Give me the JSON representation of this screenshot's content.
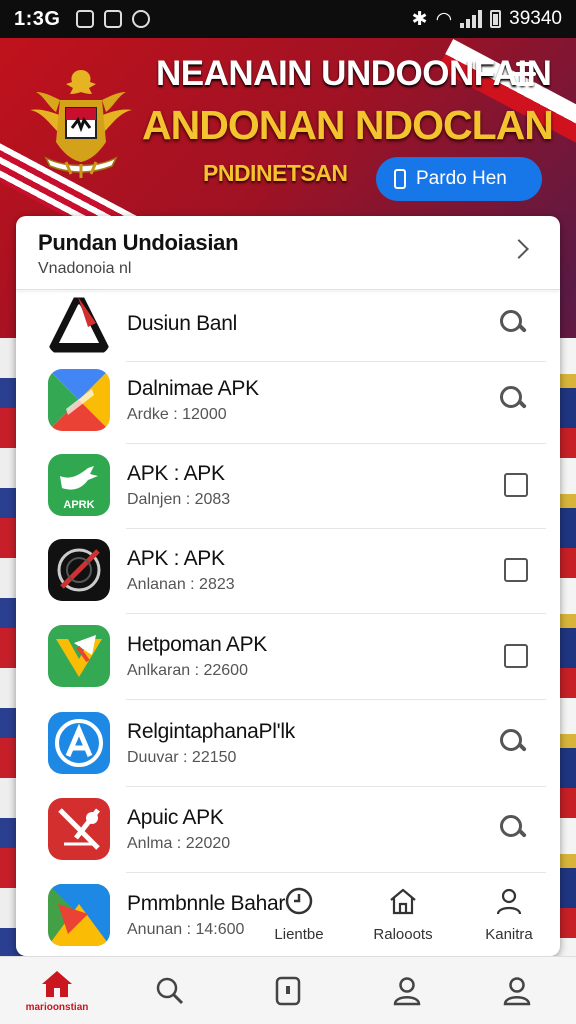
{
  "status_bar": {
    "time": "1:3G",
    "right_text": "39340"
  },
  "header": {
    "title_line1": "NEANAIN UNDOONFAIN",
    "title_line2": "ANDONAN NDOCLAN",
    "title_line3": "PNDINETSAN",
    "action_button_label": "Pardo Hen"
  },
  "panel": {
    "heading": "Pundan Undoiasian",
    "subheading": "Vnadonoia nl"
  },
  "apps": [
    {
      "name": "Dusiun Banl",
      "meta": "",
      "action_icon": "search-icon",
      "icon_color": "#ffffff"
    },
    {
      "name": "Dalnimae APK",
      "meta": "Ardke  : 12000",
      "action_icon": "search-icon",
      "icon_color": "#e94335"
    },
    {
      "name": "APK : APK",
      "meta": "Dalnjen : 2083",
      "action_icon": "checkbox-icon",
      "icon_color": "#2fa84f"
    },
    {
      "name": "APK : APK",
      "meta": "Anlanan : 2823",
      "action_icon": "checkbox-icon",
      "icon_color": "#111111"
    },
    {
      "name": "Hetpoman APK",
      "meta": "Anlkaran : 22600",
      "action_icon": "checkbox-icon",
      "icon_color": "#34a853"
    },
    {
      "name": "RelgintaphanaPl'lk",
      "meta": "Duuvar : 22150",
      "action_icon": "search-icon",
      "icon_color": "#1e88e5"
    },
    {
      "name": "Apuic APK",
      "meta": "Anlma  : 22020",
      "action_icon": "search-icon",
      "icon_color": "#d32f2f"
    },
    {
      "name": "Pmmbnnle Bahar",
      "meta": "Anunan : 14:600",
      "action_icon": "",
      "icon_color": "#43a047"
    }
  ],
  "floating_actions": [
    {
      "label": "Lientbe",
      "icon": "history-icon"
    },
    {
      "label": "Ralooots",
      "icon": "home-outline-icon"
    },
    {
      "label": "Kanitra",
      "icon": "person-icon"
    }
  ],
  "bottom_nav": {
    "home_label": "marioonstian"
  },
  "colors": {
    "brand_red": "#c0121c",
    "accent_gold": "#f4c430",
    "button_blue": "#1877e8"
  }
}
